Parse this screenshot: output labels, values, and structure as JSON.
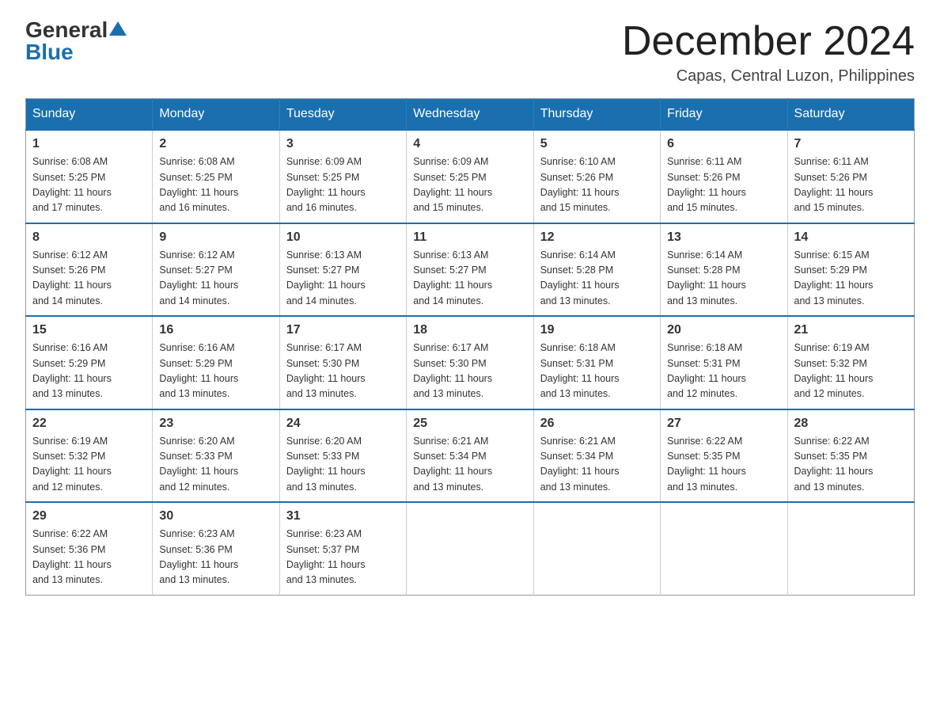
{
  "logo": {
    "general": "General",
    "blue": "Blue"
  },
  "header": {
    "month_title": "December 2024",
    "location": "Capas, Central Luzon, Philippines"
  },
  "days_of_week": [
    "Sunday",
    "Monday",
    "Tuesday",
    "Wednesday",
    "Thursday",
    "Friday",
    "Saturday"
  ],
  "weeks": [
    [
      {
        "day": "1",
        "sunrise": "6:08 AM",
        "sunset": "5:25 PM",
        "daylight": "11 hours and 17 minutes."
      },
      {
        "day": "2",
        "sunrise": "6:08 AM",
        "sunset": "5:25 PM",
        "daylight": "11 hours and 16 minutes."
      },
      {
        "day": "3",
        "sunrise": "6:09 AM",
        "sunset": "5:25 PM",
        "daylight": "11 hours and 16 minutes."
      },
      {
        "day": "4",
        "sunrise": "6:09 AM",
        "sunset": "5:25 PM",
        "daylight": "11 hours and 15 minutes."
      },
      {
        "day": "5",
        "sunrise": "6:10 AM",
        "sunset": "5:26 PM",
        "daylight": "11 hours and 15 minutes."
      },
      {
        "day": "6",
        "sunrise": "6:11 AM",
        "sunset": "5:26 PM",
        "daylight": "11 hours and 15 minutes."
      },
      {
        "day": "7",
        "sunrise": "6:11 AM",
        "sunset": "5:26 PM",
        "daylight": "11 hours and 15 minutes."
      }
    ],
    [
      {
        "day": "8",
        "sunrise": "6:12 AM",
        "sunset": "5:26 PM",
        "daylight": "11 hours and 14 minutes."
      },
      {
        "day": "9",
        "sunrise": "6:12 AM",
        "sunset": "5:27 PM",
        "daylight": "11 hours and 14 minutes."
      },
      {
        "day": "10",
        "sunrise": "6:13 AM",
        "sunset": "5:27 PM",
        "daylight": "11 hours and 14 minutes."
      },
      {
        "day": "11",
        "sunrise": "6:13 AM",
        "sunset": "5:27 PM",
        "daylight": "11 hours and 14 minutes."
      },
      {
        "day": "12",
        "sunrise": "6:14 AM",
        "sunset": "5:28 PM",
        "daylight": "11 hours and 13 minutes."
      },
      {
        "day": "13",
        "sunrise": "6:14 AM",
        "sunset": "5:28 PM",
        "daylight": "11 hours and 13 minutes."
      },
      {
        "day": "14",
        "sunrise": "6:15 AM",
        "sunset": "5:29 PM",
        "daylight": "11 hours and 13 minutes."
      }
    ],
    [
      {
        "day": "15",
        "sunrise": "6:16 AM",
        "sunset": "5:29 PM",
        "daylight": "11 hours and 13 minutes."
      },
      {
        "day": "16",
        "sunrise": "6:16 AM",
        "sunset": "5:29 PM",
        "daylight": "11 hours and 13 minutes."
      },
      {
        "day": "17",
        "sunrise": "6:17 AM",
        "sunset": "5:30 PM",
        "daylight": "11 hours and 13 minutes."
      },
      {
        "day": "18",
        "sunrise": "6:17 AM",
        "sunset": "5:30 PM",
        "daylight": "11 hours and 13 minutes."
      },
      {
        "day": "19",
        "sunrise": "6:18 AM",
        "sunset": "5:31 PM",
        "daylight": "11 hours and 13 minutes."
      },
      {
        "day": "20",
        "sunrise": "6:18 AM",
        "sunset": "5:31 PM",
        "daylight": "11 hours and 12 minutes."
      },
      {
        "day": "21",
        "sunrise": "6:19 AM",
        "sunset": "5:32 PM",
        "daylight": "11 hours and 12 minutes."
      }
    ],
    [
      {
        "day": "22",
        "sunrise": "6:19 AM",
        "sunset": "5:32 PM",
        "daylight": "11 hours and 12 minutes."
      },
      {
        "day": "23",
        "sunrise": "6:20 AM",
        "sunset": "5:33 PM",
        "daylight": "11 hours and 12 minutes."
      },
      {
        "day": "24",
        "sunrise": "6:20 AM",
        "sunset": "5:33 PM",
        "daylight": "11 hours and 13 minutes."
      },
      {
        "day": "25",
        "sunrise": "6:21 AM",
        "sunset": "5:34 PM",
        "daylight": "11 hours and 13 minutes."
      },
      {
        "day": "26",
        "sunrise": "6:21 AM",
        "sunset": "5:34 PM",
        "daylight": "11 hours and 13 minutes."
      },
      {
        "day": "27",
        "sunrise": "6:22 AM",
        "sunset": "5:35 PM",
        "daylight": "11 hours and 13 minutes."
      },
      {
        "day": "28",
        "sunrise": "6:22 AM",
        "sunset": "5:35 PM",
        "daylight": "11 hours and 13 minutes."
      }
    ],
    [
      {
        "day": "29",
        "sunrise": "6:22 AM",
        "sunset": "5:36 PM",
        "daylight": "11 hours and 13 minutes."
      },
      {
        "day": "30",
        "sunrise": "6:23 AM",
        "sunset": "5:36 PM",
        "daylight": "11 hours and 13 minutes."
      },
      {
        "day": "31",
        "sunrise": "6:23 AM",
        "sunset": "5:37 PM",
        "daylight": "11 hours and 13 minutes."
      },
      null,
      null,
      null,
      null
    ]
  ]
}
